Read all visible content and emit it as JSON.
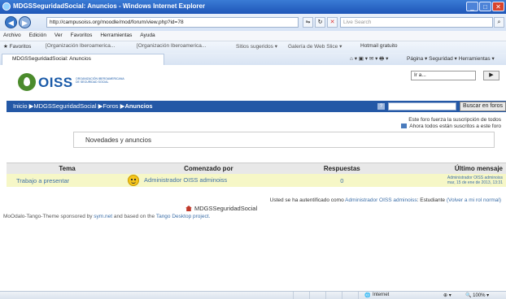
{
  "window": {
    "title": "MDGSSeguridadSocial: Anuncios - Windows Internet Explorer",
    "controls": [
      "_",
      "□",
      "✕"
    ]
  },
  "address_bar": {
    "url": "http://campusoiss.org/moodle/mod/forum/view.php?id=78",
    "search_placeholder": "Live Search"
  },
  "menu": [
    "Archivo",
    "Edición",
    "Ver",
    "Favoritos",
    "Herramientas",
    "Ayuda"
  ],
  "favorites_bar": {
    "favorites_label": "Favoritos",
    "items": [
      "[Organización Iberoamerica...",
      "[Organización Iberoamerica...",
      "Sitios sugeridos ▾",
      "Galería de Web Slice ▾",
      "Hotmail gratuito"
    ]
  },
  "tab": {
    "label": "MDGSSeguridadSocial: Anuncios",
    "tools": "Página ▾   Seguridad ▾   Herramientas ▾"
  },
  "header": {
    "logo_text": "OISS",
    "logo_subtitle": "ORGANIZACIÓN IBEROAMERICANA DE SEGURIDAD SOCIAL",
    "goto_value": "Ir a..."
  },
  "breadcrumb": {
    "inicio": "Inicio",
    "course": "MDGSSeguridadSocial",
    "foros": "Foros",
    "current": "Anuncios",
    "separator": "▶"
  },
  "search": {
    "help": "?",
    "button": "Buscar en foros"
  },
  "notices": {
    "line1": "Este foro fuerza la suscripción de todos",
    "line2": "Ahora todos están suscritos a este foro"
  },
  "news_box": "Novedades y anuncios",
  "table": {
    "headers": [
      "Tema",
      "Comenzado por",
      "Respuestas",
      "Último mensaje"
    ],
    "rows": [
      {
        "topic": "Trabajo a presentar",
        "author": "Administrador OISS adminoiss",
        "replies": "0",
        "last_author": "Administrador OISS adminoiss",
        "last_date": "mar, 15 de ene de 2013, 13:31"
      }
    ]
  },
  "login": {
    "prefix": "Usted se ha autentificado como",
    "user": "Administrador OISS adminoiss",
    "role": ": Estudiante",
    "back_link": "(Volver a mi rol normal)"
  },
  "home_link": "MDGSSeguridadSocial",
  "footer": {
    "text1": "MoOdalo-Tango-Theme sponsored by",
    "sponsor": "sym.net",
    "text2": "and based on the",
    "project": "Tango Desktop project."
  },
  "statusbar": {
    "zone": "Internet",
    "zoom": "100%"
  },
  "colors": {
    "titlebar": "#1f56b8",
    "breadcrumb_bg": "#2458a6",
    "row_bg": "#f6f7c7",
    "link": "#3d6fa8",
    "logo_green": "#4b8b2c"
  }
}
